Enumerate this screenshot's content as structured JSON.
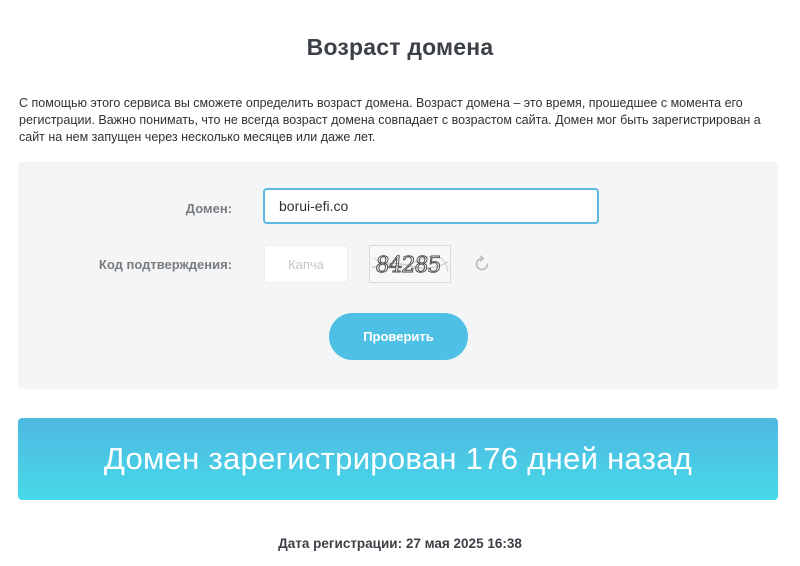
{
  "page": {
    "title": "Возраст домена",
    "description": "С помощью этого сервиса вы сможете определить возраст домена. Возраст домена – это время, прошедшее с момента его регистрации. Важно понимать, что не всегда возраст домена совпадает с возрастом сайта. Домен мог быть зарегистрирован а сайт на нем запущен через несколько месяцев или даже лет."
  },
  "form": {
    "domain_label": "Домен:",
    "domain_value": "borui-efi.co",
    "captcha_label": "Код подтверждения:",
    "captcha_placeholder": "Капча",
    "captcha_image_text": "84285",
    "refresh_icon": "refresh-icon",
    "submit_label": "Проверить"
  },
  "result": {
    "banner_text": "Домен зарегистрирован 176 дней назад",
    "registration_date": "Дата регистрации: 27 мая 2025 16:38"
  },
  "colors": {
    "accent": "#4ec0e6",
    "input_border": "#5bb8e0",
    "banner_top": "#4fb8e2",
    "banner_bottom": "#46d9e8",
    "panel_bg": "#f4f5f6"
  }
}
